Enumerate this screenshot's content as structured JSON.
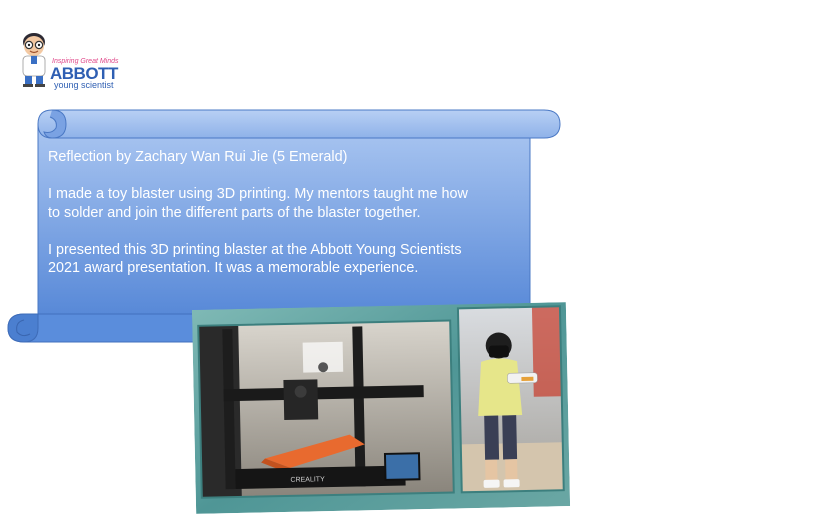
{
  "logo": {
    "tagline": "Inspiring Great Minds",
    "brand": "ABBOTT",
    "subtitle": "young scientist"
  },
  "reflection": {
    "heading": "Reflection by Zachary Wan Rui Jie (5 Emerald)",
    "paragraph1_line1": "I made a toy blaster using 3D printing.  My mentors taught me how",
    "paragraph1_line2": "to solder and join the different parts of the blaster together.",
    "paragraph2_line1": "I presented this 3D printing blaster at the Abbott Young Scientists",
    "paragraph2_line2": "2021 award presentation. It was a memorable experience."
  },
  "photos": {
    "printer_label": "CREALITY"
  },
  "colors": {
    "scroll_top": "#a8c4ef",
    "scroll_bottom": "#4f83d6",
    "scroll_edge": "#3d6fc2",
    "collage_frame": "#5fa3a3"
  }
}
